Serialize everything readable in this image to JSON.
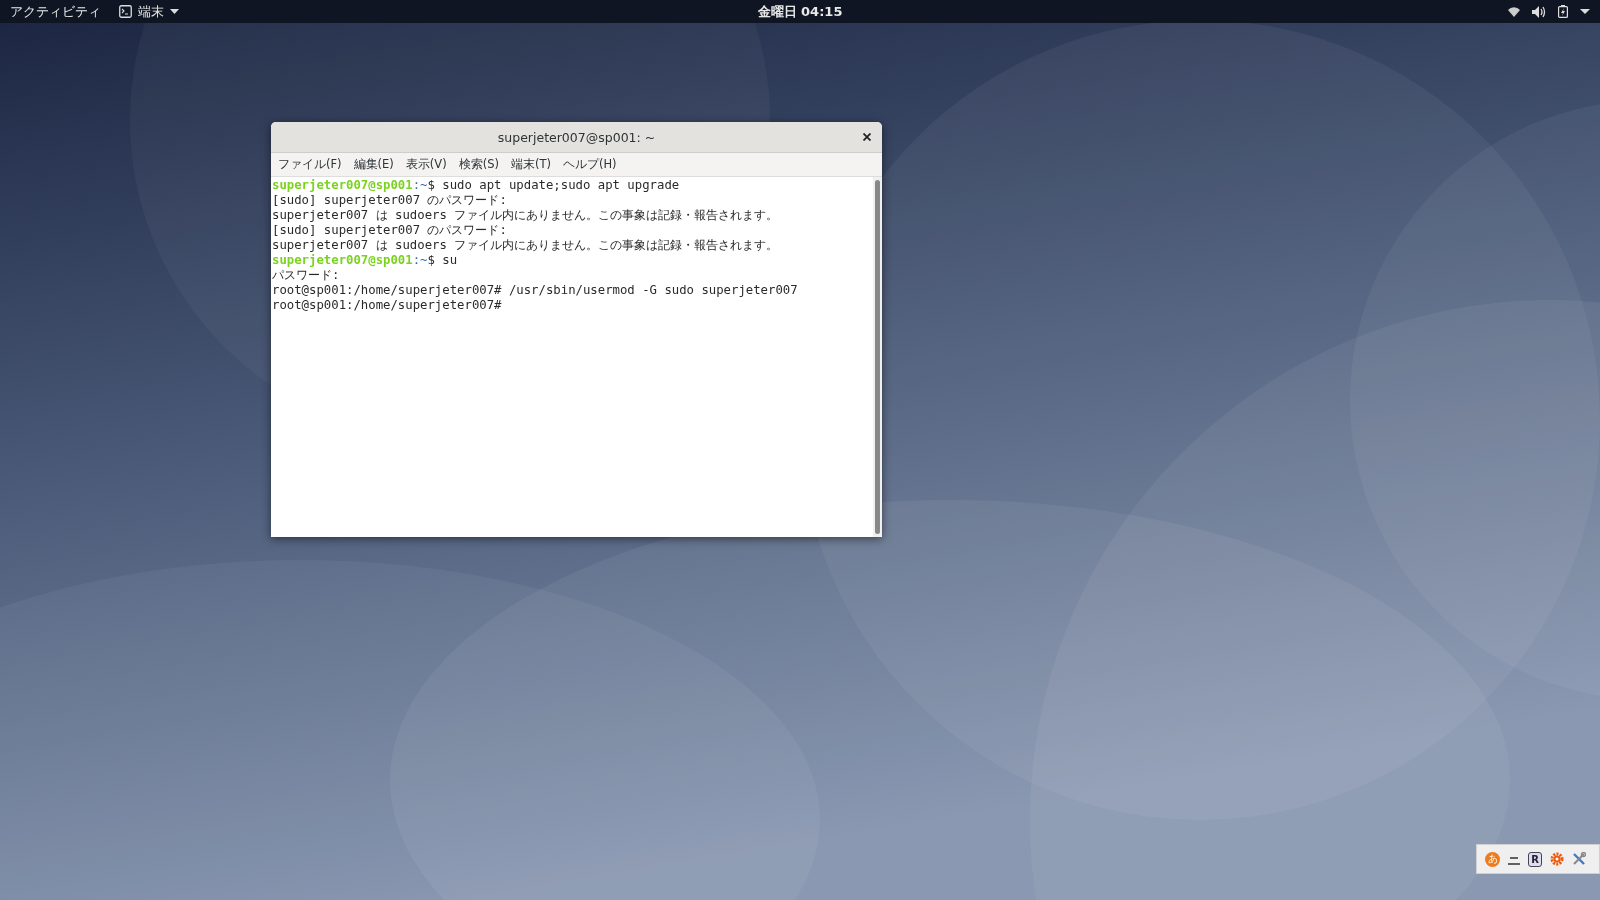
{
  "top_bar": {
    "activities": "アクティビティ",
    "app_menu": "端末",
    "clock": "金曜日 04:15"
  },
  "window": {
    "title": "superjeter007@sp001: ~",
    "menu": [
      "ファイル(F)",
      "編集(E)",
      "表示(V)",
      "検索(S)",
      "端末(T)",
      "ヘルプ(H)"
    ],
    "terminal_lines": [
      {
        "kind": "prompt",
        "user": "superjeter007@sp001",
        "path": ":~",
        "command": "$ sudo apt update;sudo apt upgrade"
      },
      {
        "kind": "text",
        "text": "[sudo] superjeter007 のパスワード:"
      },
      {
        "kind": "text",
        "text": "superjeter007 は sudoers ファイル内にありません。この事象は記録・報告されます。"
      },
      {
        "kind": "text",
        "text": "[sudo] superjeter007 のパスワード:"
      },
      {
        "kind": "text",
        "text": "superjeter007 は sudoers ファイル内にありません。この事象は記録・報告されます。"
      },
      {
        "kind": "prompt",
        "user": "superjeter007@sp001",
        "path": ":~",
        "command": "$ su"
      },
      {
        "kind": "text",
        "text": "パスワード:"
      },
      {
        "kind": "text",
        "text": "root@sp001:/home/superjeter007# /usr/sbin/usermod -G sudo superjeter007"
      },
      {
        "kind": "text",
        "text": "root@sp001:/home/superjeter007#"
      }
    ]
  },
  "tray": [
    {
      "kind": "ime",
      "label": "あ"
    },
    {
      "kind": "dash"
    },
    {
      "kind": "letter",
      "label": "R"
    },
    {
      "kind": "gear"
    },
    {
      "kind": "tools"
    }
  ]
}
